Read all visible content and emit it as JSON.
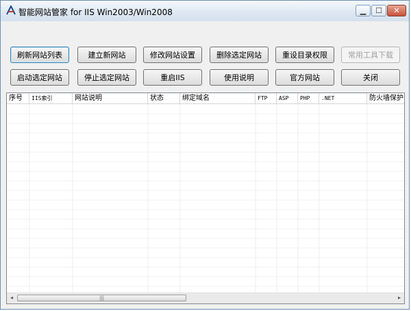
{
  "window": {
    "title": "智能网站管家 for IIS Win2003/Win2008",
    "controls": {
      "minimize": "▁",
      "maximize": "☐",
      "close": "✕"
    }
  },
  "toolbar": {
    "row1": [
      {
        "label": "刷新网站列表",
        "state": "focused"
      },
      {
        "label": "建立新网站",
        "state": "enabled"
      },
      {
        "label": "修改网站设置",
        "state": "enabled"
      },
      {
        "label": "删除选定网站",
        "state": "enabled"
      },
      {
        "label": "重设目录权限",
        "state": "enabled"
      },
      {
        "label": "常用工具下载",
        "state": "disabled"
      }
    ],
    "row2": [
      {
        "label": "启动选定网站",
        "state": "enabled"
      },
      {
        "label": "停止选定网站",
        "state": "enabled"
      },
      {
        "label": "重启IIS",
        "state": "enabled"
      },
      {
        "label": "使用说明",
        "state": "enabled"
      },
      {
        "label": "官方网站",
        "state": "enabled"
      },
      {
        "label": "关闭",
        "state": "enabled"
      }
    ]
  },
  "site_list": {
    "columns": [
      "序号",
      "IIS索引",
      "网站说明",
      "状态",
      "绑定域名",
      "FTP",
      "ASP",
      "PHP",
      ".NET",
      "防火墙保护"
    ],
    "rows": [],
    "scrollbar": {
      "left_arrow": "◂",
      "right_arrow": "▸",
      "grip": "|||"
    }
  }
}
